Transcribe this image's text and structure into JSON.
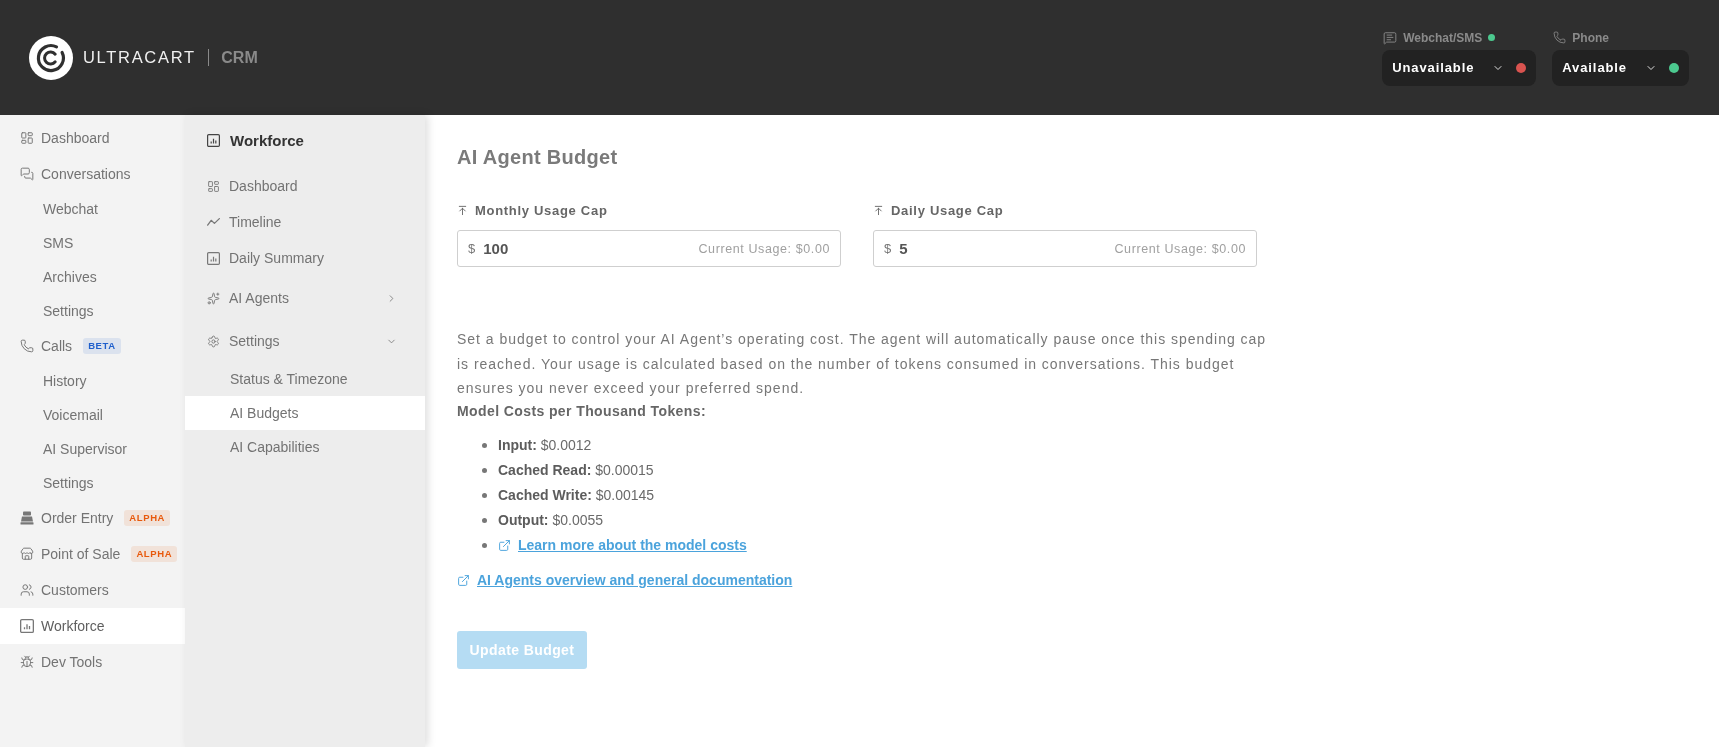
{
  "header": {
    "brand": "ULTRACART",
    "product": "CRM",
    "channels": [
      {
        "label": "Webchat/SMS",
        "online": true,
        "status": "Unavailable",
        "color": "#d9534f"
      },
      {
        "label": "Phone",
        "online": false,
        "status": "Available",
        "color": "#4cc98f"
      }
    ]
  },
  "sidebar": {
    "items": [
      {
        "label": "Dashboard",
        "selected": false
      },
      {
        "label": "Conversations",
        "selected": false,
        "children": [
          {
            "label": "Webchat",
            "selected": false
          },
          {
            "label": "SMS",
            "selected": false
          },
          {
            "label": "Archives",
            "selected": false
          },
          {
            "label": "Settings",
            "selected": false
          }
        ]
      },
      {
        "label": "Calls",
        "selected": false,
        "badge": {
          "text": "BETA",
          "color": "#1f5fcc"
        },
        "children": [
          {
            "label": "History",
            "selected": false
          },
          {
            "label": "Voicemail",
            "selected": false
          },
          {
            "label": "AI Supervisor",
            "selected": false
          },
          {
            "label": "Settings",
            "selected": false
          }
        ]
      },
      {
        "label": "Order Entry",
        "selected": false,
        "badge": {
          "text": "ALPHA",
          "color": "#e8590c"
        }
      },
      {
        "label": "Point of Sale",
        "selected": false,
        "badge": {
          "text": "ALPHA",
          "color": "#e8590c"
        }
      },
      {
        "label": "Customers",
        "selected": false
      },
      {
        "label": "Workforce",
        "selected": true
      },
      {
        "label": "Dev Tools",
        "selected": false
      }
    ]
  },
  "subnav": {
    "title": "Workforce",
    "items": [
      {
        "label": "Dashboard",
        "selected": false
      },
      {
        "label": "Timeline",
        "selected": false
      },
      {
        "label": "Daily Summary",
        "selected": false
      },
      {
        "label": "AI Agents",
        "selected": false,
        "expanded": false
      },
      {
        "label": "Settings",
        "selected": false,
        "expanded": true,
        "children": [
          {
            "label": "Status & Timezone",
            "selected": false
          },
          {
            "label": "AI Budgets",
            "selected": true
          },
          {
            "label": "AI Capabilities",
            "selected": false
          }
        ]
      }
    ]
  },
  "budget": {
    "title": "AI Agent Budget",
    "caps": [
      {
        "label": "Monthly Usage Cap",
        "currency": "$",
        "value": "100",
        "usage": "Current Usage: $0.00"
      },
      {
        "label": "Daily Usage Cap",
        "currency": "$",
        "value": "5",
        "usage": "Current Usage: $0.00"
      }
    ],
    "description": "Set a budget to control your AI Agent’s operating cost. The agent will automatically pause once this spending cap is reached. Your usage is calculated based on the number of tokens consumed in conversations. This budget ensures you never exceed your preferred spend.",
    "costs_heading": "Model Costs per Thousand Tokens:",
    "costs": [
      {
        "kind": "price",
        "text": "**Input:** $0.0012"
      },
      {
        "kind": "price",
        "text": "**Cached Read:** $0.00015"
      },
      {
        "kind": "price",
        "text": "**Cached Write:** $0.00145"
      },
      {
        "kind": "price",
        "text": "**Output:** $0.0055"
      },
      {
        "kind": "link",
        "text": "Learn more about the model costs"
      }
    ],
    "doc_link": "AI Agents overview and general documentation",
    "submit": {
      "label": "Update Budget",
      "disabled": true
    }
  }
}
